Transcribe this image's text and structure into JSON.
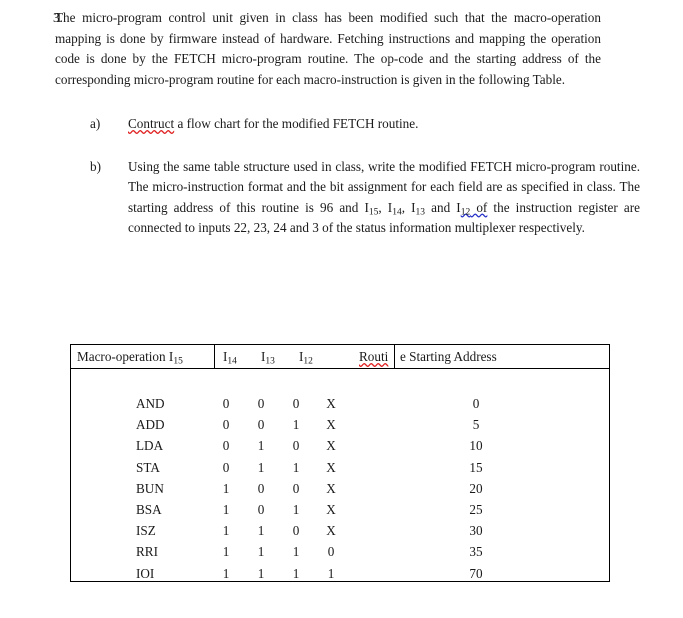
{
  "question": {
    "number": "3.",
    "text": "The micro-program control unit given in class has been modified such that the macro-operation mapping is done by firmware instead of hardware.  Fetching instructions and mapping the operation code is done by the FETCH micro-program routine.  The op-code and the starting address of the corresponding micro-program routine for each macro-instruction is given in the following Table."
  },
  "parts": {
    "a": {
      "label": "a)",
      "misspelled_word": "Contruct",
      "text_after": " a flow chart for the modified FETCH routine."
    },
    "b": {
      "label": "b)",
      "segment_1": "Using the same table structure used in class, write the modified FETCH micro-program routine.  The micro-instruction format and the bit assignment for each field are as specified in class. The starting address of this routine is 96 and I",
      "sub_1": "15",
      "segment_2": ", I",
      "sub_2": "14",
      "segment_3": ", I",
      "sub_3": "13",
      "segment_4": " and I",
      "sub_4": "12",
      "grammar_flagged": " of",
      "segment_5": " the instruction register are connected to inputs 22, 23, 24 and 3 of the status information multiplexer respectively."
    }
  },
  "table": {
    "header": {
      "col_macro_label": "Macro-operation I",
      "col_macro_sub": "15",
      "col_i14_label": "I",
      "col_i14_sub": "14",
      "col_i13_label": "I",
      "col_i13_sub": "13",
      "col_i12_label": "I",
      "col_i12_sub": "12",
      "col_routine_clipped": "Routi",
      "col_routine_rest": "e Starting Address"
    },
    "rows": [
      {
        "mnemonic": "AND",
        "i15": "0",
        "i14": "0",
        "i13": "0",
        "i12": "X",
        "address": "0"
      },
      {
        "mnemonic": "ADD",
        "i15": "0",
        "i14": "0",
        "i13": "1",
        "i12": "X",
        "address": "5"
      },
      {
        "mnemonic": "LDA",
        "i15": "0",
        "i14": "1",
        "i13": "0",
        "i12": "X",
        "address": "10"
      },
      {
        "mnemonic": "STA",
        "i15": "0",
        "i14": "1",
        "i13": "1",
        "i12": "X",
        "address": "15"
      },
      {
        "mnemonic": "BUN",
        "i15": "1",
        "i14": "0",
        "i13": "0",
        "i12": "X",
        "address": "20"
      },
      {
        "mnemonic": "BSA",
        "i15": "1",
        "i14": "0",
        "i13": "1",
        "i12": "X",
        "address": "25"
      },
      {
        "mnemonic": "ISZ",
        "i15": "1",
        "i14": "1",
        "i13": "0",
        "i12": "X",
        "address": "30"
      },
      {
        "mnemonic": "RRI",
        "i15": "1",
        "i14": "1",
        "i13": "1",
        "i12": "0",
        "address": "35"
      },
      {
        "mnemonic": "IOI",
        "i15": "1",
        "i14": "1",
        "i13": "1",
        "i12": "1",
        "address": "70"
      }
    ]
  },
  "colors": {
    "spellcheck_red": "#e02020",
    "grammarcheck_blue": "#2a35c8",
    "text": "#1a1a1a",
    "rule": "#000000",
    "background": "#ffffff"
  }
}
